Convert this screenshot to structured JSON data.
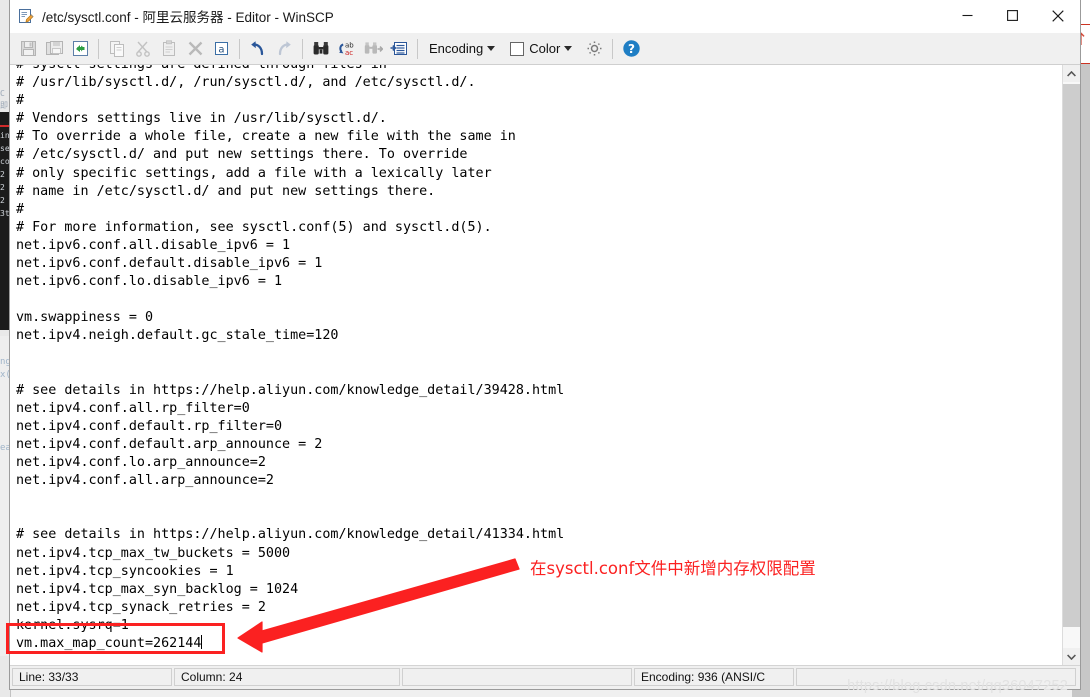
{
  "window": {
    "title": "/etc/sysctl.conf - 阿里云服务器 - Editor - WinSCP",
    "icon": "editor-document-pencil-icon",
    "controls": {
      "minimize": "minimize-icon",
      "maximize": "maximize-icon",
      "close": "close-icon"
    }
  },
  "toolbar": {
    "buttons": [
      {
        "name": "save-button",
        "icon": "floppy-save-icon",
        "enabled": false
      },
      {
        "name": "save-as-button",
        "icon": "save-copy-icon",
        "enabled": false
      },
      {
        "name": "reload-button",
        "icon": "reload-refresh-icon",
        "enabled": true
      },
      {
        "name": "copy-button",
        "icon": "copy-icon",
        "enabled": false
      },
      {
        "name": "cut-button",
        "icon": "scissors-cut-icon",
        "enabled": false
      },
      {
        "name": "paste-button",
        "icon": "clipboard-paste-icon",
        "enabled": false
      },
      {
        "name": "delete-button",
        "icon": "delete-x-icon",
        "enabled": false
      },
      {
        "name": "select-all-button",
        "icon": "select-all-a-icon",
        "enabled": true
      },
      {
        "name": "undo-button",
        "icon": "undo-arrow-icon",
        "enabled": true
      },
      {
        "name": "redo-button",
        "icon": "redo-arrow-icon",
        "enabled": false
      },
      {
        "name": "find-button",
        "icon": "binoculars-find-icon",
        "enabled": true
      },
      {
        "name": "replace-button",
        "icon": "replace-ab-ac-icon",
        "enabled": true
      },
      {
        "name": "find-next-button",
        "icon": "find-next-icon",
        "enabled": false
      },
      {
        "name": "go-to-line-button",
        "icon": "goto-line-icon",
        "enabled": true
      }
    ],
    "encoding_label": "Encoding",
    "color_label": "Color",
    "settings_icon": "gear-settings-icon",
    "help_icon": "help-question-icon"
  },
  "editor": {
    "lines": [
      "# sysctl settings are defined through files in",
      "# /usr/lib/sysctl.d/, /run/sysctl.d/, and /etc/sysctl.d/.",
      "#",
      "# Vendors settings live in /usr/lib/sysctl.d/.",
      "# To override a whole file, create a new file with the same in",
      "# /etc/sysctl.d/ and put new settings there. To override",
      "# only specific settings, add a file with a lexically later",
      "# name in /etc/sysctl.d/ and put new settings there.",
      "#",
      "# For more information, see sysctl.conf(5) and sysctl.d(5).",
      "net.ipv6.conf.all.disable_ipv6 = 1",
      "net.ipv6.conf.default.disable_ipv6 = 1",
      "net.ipv6.conf.lo.disable_ipv6 = 1",
      "",
      "vm.swappiness = 0",
      "net.ipv4.neigh.default.gc_stale_time=120",
      "",
      "",
      "# see details in https://help.aliyun.com/knowledge_detail/39428.html",
      "net.ipv4.conf.all.rp_filter=0",
      "net.ipv4.conf.default.rp_filter=0",
      "net.ipv4.conf.default.arp_announce = 2",
      "net.ipv4.conf.lo.arp_announce=2",
      "net.ipv4.conf.all.arp_announce=2",
      "",
      "",
      "# see details in https://help.aliyun.com/knowledge_detail/41334.html",
      "net.ipv4.tcp_max_tw_buckets = 5000",
      "net.ipv4.tcp_syncookies = 1",
      "net.ipv4.tcp_max_syn_backlog = 1024",
      "net.ipv4.tcp_synack_retries = 2",
      "kernel.sysrq=1"
    ],
    "current_line_text": "vm.max_map_count=262144"
  },
  "statusbar": {
    "line": "Line: 33/33",
    "column": "Column: 24",
    "blank1": "",
    "encoding": "Encoding: 936   (ANSI/C",
    "blank2": ""
  },
  "annotation": {
    "text": "在sysctl.conf文件中新增内存权限配置",
    "color": "#fb2121",
    "highlight_box": "vm.max_map_count=262144",
    "arrow": "red-arrow-pointing-left-down"
  },
  "watermark": {
    "text": "https://blog.csdn.net/qq36047252"
  },
  "background_window": {
    "left_strip_lines": [
      "in",
      "se",
      "co",
      "2",
      "2",
      "2",
      "3t"
    ],
    "lower_lines": [
      "ng",
      "x(",
      "ea"
    ]
  }
}
